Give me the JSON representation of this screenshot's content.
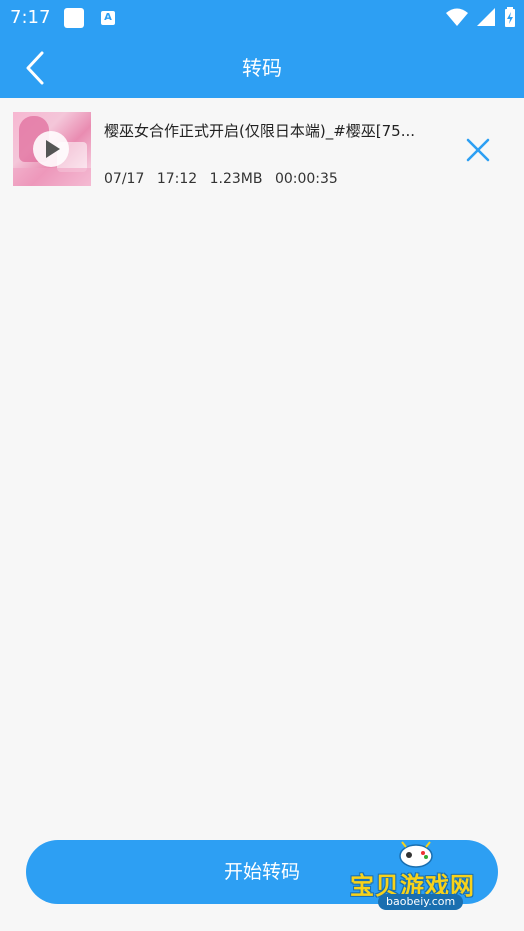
{
  "status_bar": {
    "time": "7:17",
    "notification_letter": "A"
  },
  "header": {
    "title": "转码",
    "back_icon": "chevron-left-icon"
  },
  "video": {
    "title": "樱巫女合作正式开启(仅限日本端)_#樱巫[75...",
    "date": "07/17",
    "time": "17:12",
    "size": "1.23MB",
    "duration": "00:00:35",
    "play_icon": "play-icon",
    "remove_icon": "close-icon"
  },
  "footer": {
    "start_label": "开始转码"
  },
  "watermark": {
    "text": "宝贝游戏网",
    "url": "baobeiy.com"
  },
  "colors": {
    "primary": "#2d9ff3",
    "background": "#f7f7f7",
    "watermark_yellow": "#f7d21a"
  }
}
